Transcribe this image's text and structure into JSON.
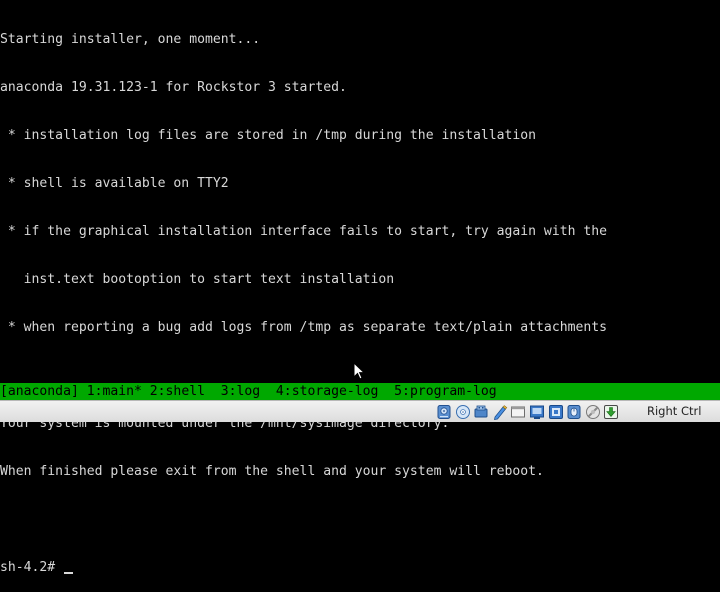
{
  "console": {
    "lines": [
      "Starting installer, one moment...",
      "anaconda 19.31.123-1 for Rockstor 3 started.",
      " * installation log files are stored in /tmp during the installation",
      " * shell is available on TTY2",
      " * if the graphical installation interface fails to start, try again with the",
      "   inst.text bootoption to start text installation",
      " * when reporting a bug add logs from /tmp as separate text/plain attachments",
      "",
      "Your system is mounted under the /mnt/sysimage directory.",
      "When finished please exit from the shell and your system will reboot.",
      ""
    ],
    "prompt": "sh-4.2# "
  },
  "tmux": {
    "windows": [
      "[anaconda] 1:main* ",
      "2:shell  ",
      "3:log  ",
      "4:storage-log  ",
      "5:program-log"
    ]
  },
  "vbox_status": {
    "icons": [
      "hard-disk-icon",
      "optical-drive-icon",
      "usb-icon",
      "shared-folders-icon",
      "display-icon",
      "network-icon",
      "video-capture-icon",
      "mouse-integration-icon",
      "cpu-icon",
      "host-key-arrow-icon"
    ],
    "host_key_label": "Right Ctrl"
  },
  "colors": {
    "console_bg": "#000000",
    "console_fg": "#d8d8d8",
    "tmux_bg": "#00a800",
    "tmux_fg": "#000000",
    "status_bg": "#e6e6e6"
  }
}
